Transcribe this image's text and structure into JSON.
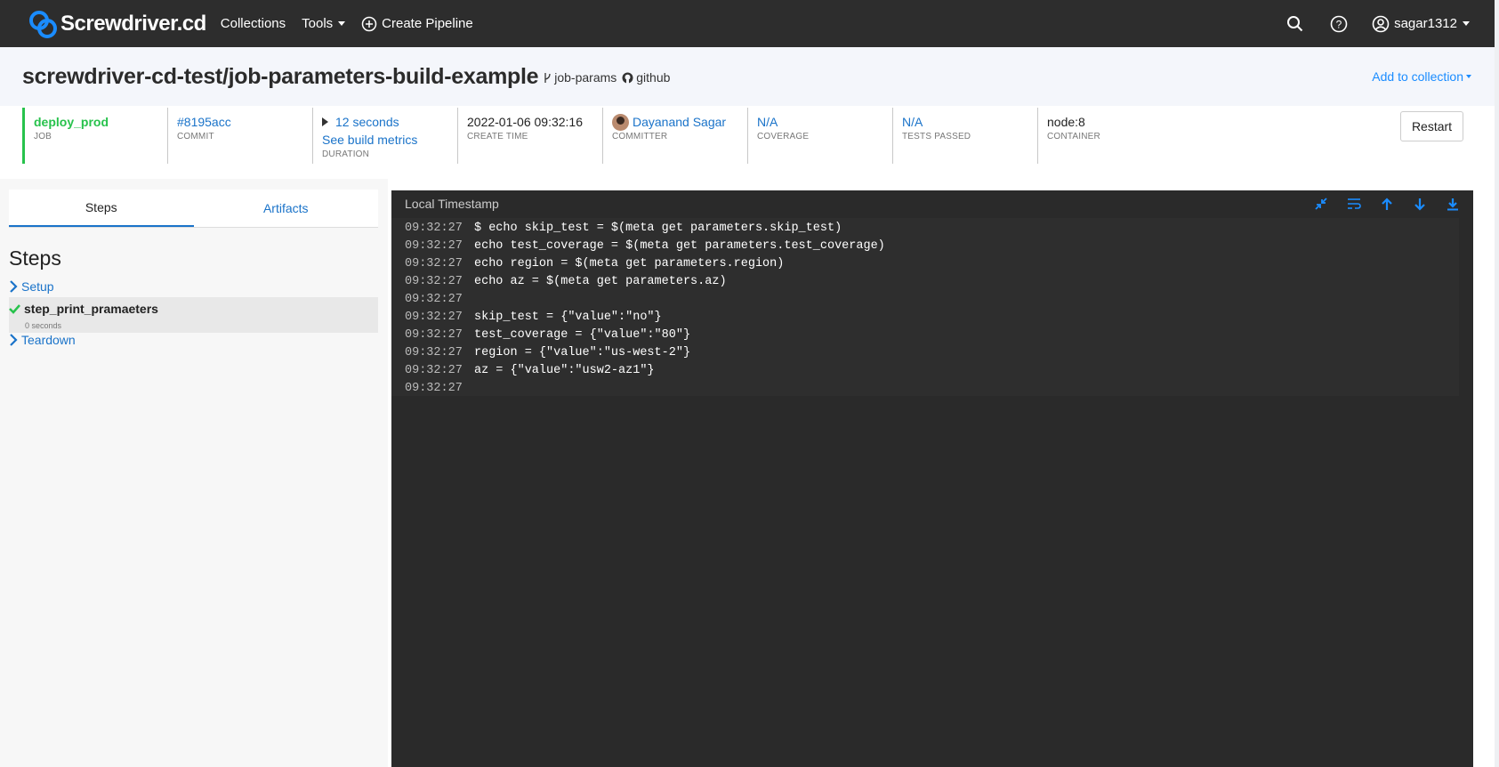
{
  "navbar": {
    "brand": "Screwdriver.cd",
    "items": {
      "collections": "Collections",
      "tools": "Tools",
      "create_pipeline": "Create Pipeline"
    },
    "user": "sagar1312"
  },
  "header": {
    "title": "screwdriver-cd-test/job-parameters-build-example",
    "branch": "job-params",
    "scm": "github",
    "add_to_collection": "Add to collection"
  },
  "banner": {
    "job": {
      "value": "deploy_prod",
      "label": "JOB"
    },
    "commit": {
      "value": "#8195acc",
      "label": "COMMIT"
    },
    "duration": {
      "value": "12 seconds",
      "metrics_link": "See build metrics",
      "label": "DURATION"
    },
    "create_time": {
      "value": "2022-01-06 09:32:16",
      "label": "CREATE TIME"
    },
    "committer": {
      "value": "Dayanand Sagar",
      "label": "COMMITTER"
    },
    "coverage": {
      "value": "N/A",
      "label": "COVERAGE"
    },
    "tests_passed": {
      "value": "N/A",
      "label": "TESTS PASSED"
    },
    "container": {
      "value": "node:8",
      "label": "CONTAINER"
    },
    "restart_label": "Restart",
    "status_color": "#27c24c"
  },
  "sidebar": {
    "tabs": {
      "steps": "Steps",
      "artifacts": "Artifacts"
    },
    "heading": "Steps",
    "steps": {
      "setup": "Setup",
      "active": {
        "name": "step_print_pramaeters",
        "duration": "0 seconds"
      },
      "teardown": "Teardown"
    }
  },
  "log": {
    "title": "Local Timestamp",
    "lines": [
      {
        "ts": "09:32:27",
        "text": "$ echo skip_test = $(meta get parameters.skip_test)"
      },
      {
        "ts": "09:32:27",
        "text": "echo test_coverage = $(meta get parameters.test_coverage)"
      },
      {
        "ts": "09:32:27",
        "text": "echo region = $(meta get parameters.region)"
      },
      {
        "ts": "09:32:27",
        "text": "echo az = $(meta get parameters.az)"
      },
      {
        "ts": "09:32:27",
        "text": ""
      },
      {
        "ts": "09:32:27",
        "text": "skip_test = {\"value\":\"no\"}"
      },
      {
        "ts": "09:32:27",
        "text": "test_coverage = {\"value\":\"80\"}"
      },
      {
        "ts": "09:32:27",
        "text": "region = {\"value\":\"us-west-2\"}"
      },
      {
        "ts": "09:32:27",
        "text": "az = {\"value\":\"usw2-az1\"}"
      },
      {
        "ts": "09:32:27",
        "text": ""
      }
    ]
  },
  "colors": {
    "navbar_bg": "#2d2d2d",
    "link": "#1a73c9",
    "accent": "#1a8cff",
    "success": "#27c24c",
    "log_bg": "#2a2a2a"
  }
}
